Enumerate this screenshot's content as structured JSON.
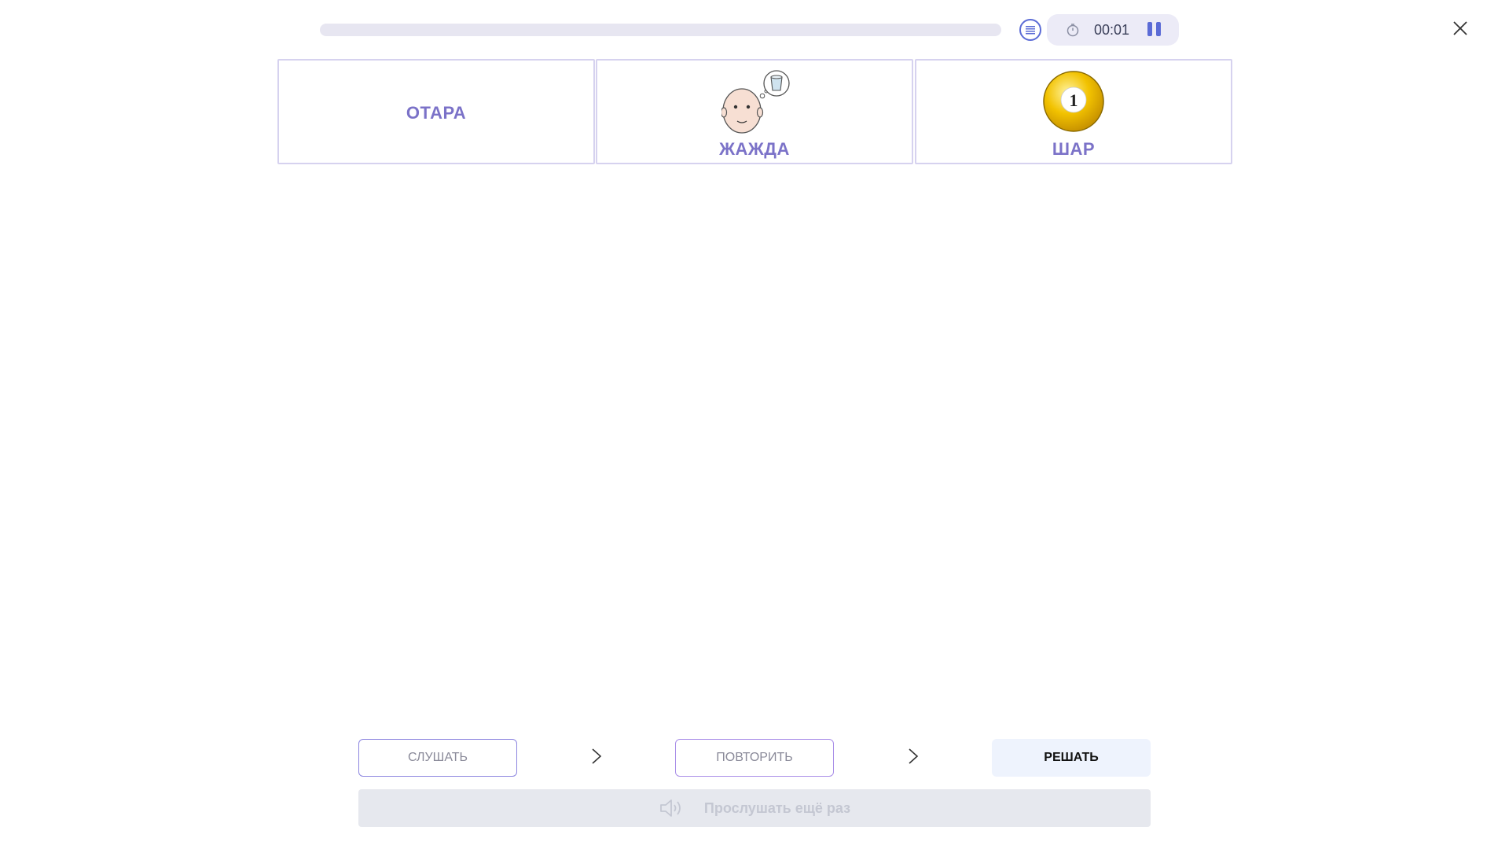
{
  "top_bar": {
    "progress_fraction": 0.0,
    "timer": "00:01",
    "icons": {
      "list": "list-icon",
      "timer": "stopwatch-icon",
      "pause": "pause-icon",
      "close": "close-icon"
    }
  },
  "cards": [
    {
      "word": "ОТАРА",
      "picture": null
    },
    {
      "word": "ЖАЖДА",
      "picture": "thirsty-face-icon"
    },
    {
      "word": "ШАР",
      "picture": "ball-icon",
      "ball_number": "1"
    }
  ],
  "steps": {
    "listen": "СЛУШАТЬ",
    "repeat": "ПОВТОРИТЬ",
    "solve": "РЕШАТЬ"
  },
  "replay": {
    "label": "Прослушать ещё раз",
    "icon": "speaker-icon"
  },
  "colors": {
    "accent": "#7b72c8",
    "icon_blue": "#5b6bd6",
    "card_border": "#d6d2ef",
    "solve_bg": "#eef3fd",
    "replay_bg": "#e6e8ee"
  }
}
